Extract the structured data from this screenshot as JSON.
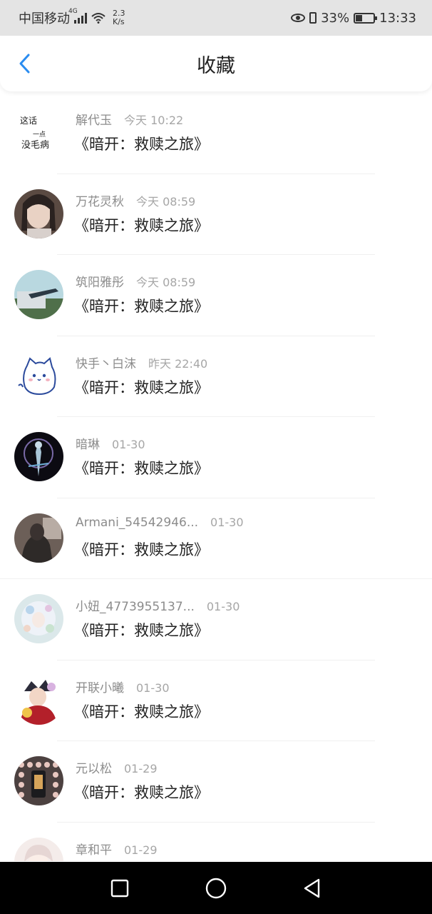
{
  "status_bar": {
    "carrier": "中国移动",
    "network": "4G",
    "speed_value": "2.3",
    "speed_unit": "K/s",
    "battery": "33%",
    "battery_level": 0.33,
    "time": "13:33"
  },
  "header": {
    "title": "收藏",
    "back_icon": "chevron-left-icon",
    "accent": "#2a8cf0"
  },
  "favorites": [
    {
      "name": "解代玉",
      "time": "今天 10:22",
      "content": "《暗开：救赎之旅》"
    },
    {
      "name": "万花灵秋",
      "time": "今天 08:59",
      "content": "《暗开：救赎之旅》"
    },
    {
      "name": "筑阳雅彤",
      "time": "今天 08:59",
      "content": "《暗开：救赎之旅》"
    },
    {
      "name": "快手丶白沫",
      "time": "昨天 22:40",
      "content": "《暗开：救赎之旅》"
    },
    {
      "name": "暗琳",
      "time": "01-30",
      "content": "《暗开：救赎之旅》"
    },
    {
      "name": "Armani_54542946...",
      "time": "01-30",
      "content": "《暗开：救赎之旅》"
    },
    {
      "name": "小妞_4773955137...",
      "time": "01-30",
      "content": "《暗开：救赎之旅》"
    },
    {
      "name": "开联小曦",
      "time": "01-30",
      "content": "《暗开：救赎之旅》"
    },
    {
      "name": "元以松",
      "time": "01-29",
      "content": "《暗开：救赎之旅》"
    },
    {
      "name": "章和平",
      "time": "01-29",
      "content": ""
    }
  ],
  "avatar_badge": {
    "line1": "这话",
    "line2": "一点",
    "line3": "没毛病"
  },
  "nav_bar": {
    "recents_icon": "square-icon",
    "home_icon": "circle-icon",
    "back_icon": "triangle-back-icon"
  }
}
